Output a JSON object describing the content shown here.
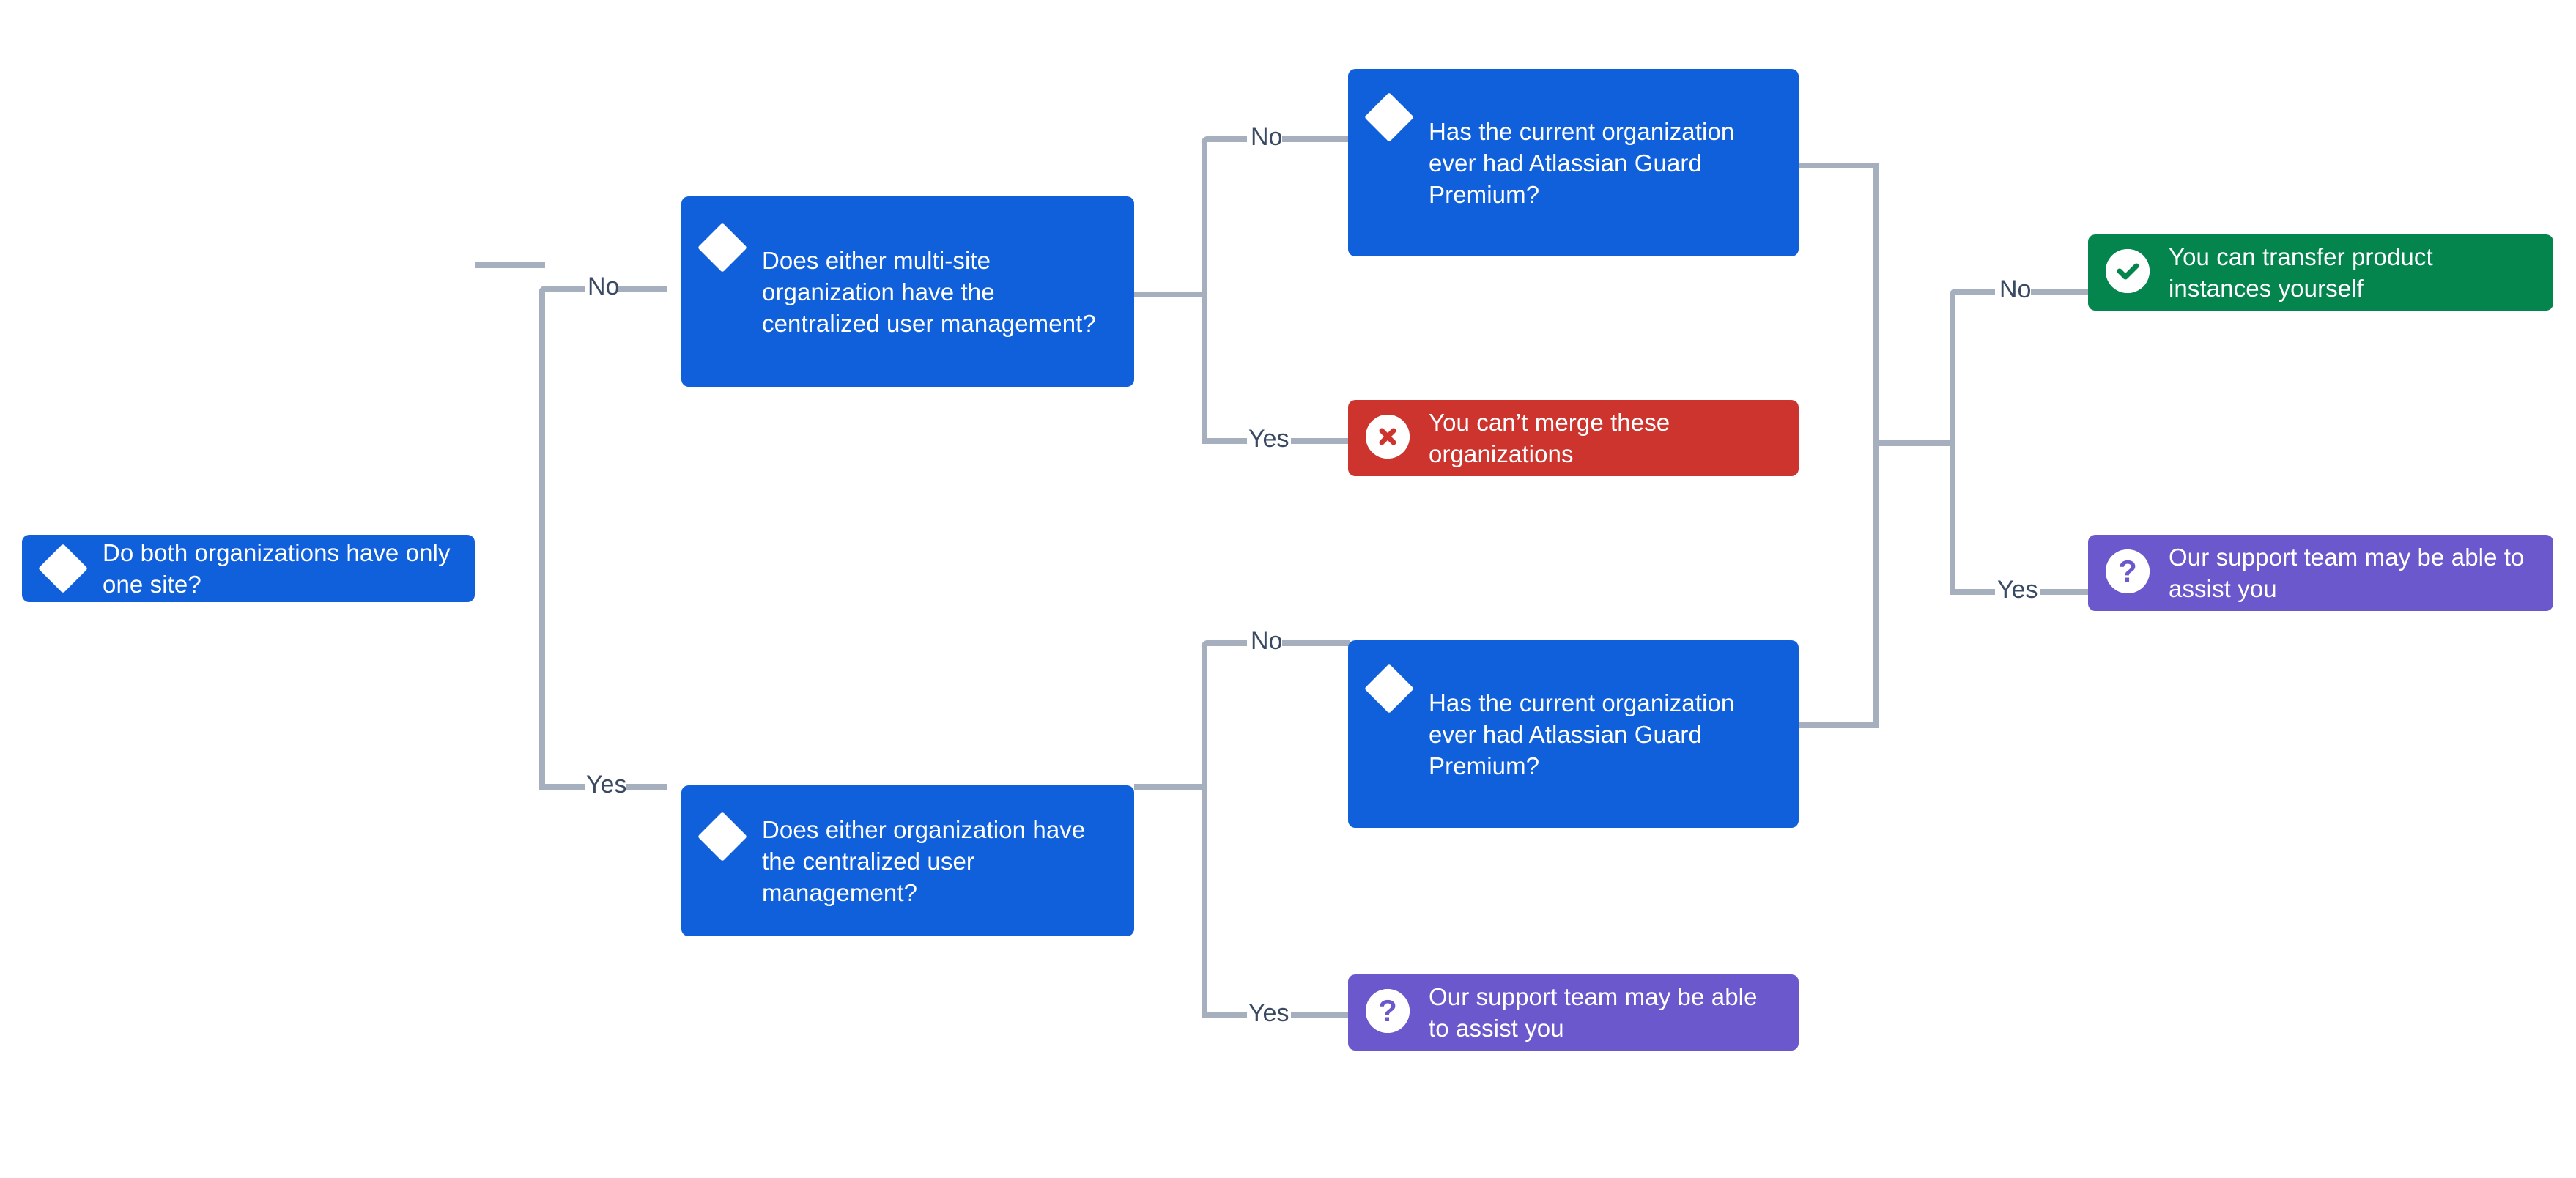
{
  "diagram": {
    "type": "decision-tree",
    "title": "Organization merge decision tree",
    "colors": {
      "decision": "#1060DC",
      "error": "#CC342D",
      "success": "#04854E",
      "info": "#6A58CC",
      "connector": "#A5AFBE",
      "edge_label": "#3B4A63",
      "background": "#FFFFFF"
    },
    "nodes": [
      {
        "id": "root",
        "kind": "decision",
        "icon": "diamond-icon",
        "text": "Do both organizations have only one site?"
      },
      {
        "id": "multisite-cum",
        "kind": "decision",
        "icon": "diamond-icon",
        "text": "Does either multi-site organization have the centralized user management?"
      },
      {
        "id": "guard-top",
        "kind": "decision",
        "icon": "diamond-icon",
        "text": "Has the current organization ever had Atlassian Guard Premium?"
      },
      {
        "id": "cannot-merge",
        "kind": "error",
        "icon": "error-cross-icon",
        "text": "You can’t merge these organizations"
      },
      {
        "id": "single-cum",
        "kind": "decision",
        "icon": "diamond-icon",
        "text": "Does either organization have the centralized user management?"
      },
      {
        "id": "guard-bottom",
        "kind": "decision",
        "icon": "diamond-icon",
        "text": "Has the current organization ever had Atlassian Guard Premium?"
      },
      {
        "id": "support-bottom",
        "kind": "info",
        "icon": "question-mark-icon",
        "text": "Our support team may be able to assist you"
      },
      {
        "id": "transfer-yourself",
        "kind": "success",
        "icon": "check-circle-icon",
        "text": "You can transfer product instances yourself"
      },
      {
        "id": "support-right",
        "kind": "info",
        "icon": "question-mark-icon",
        "text": "Our support team may be able to assist you"
      }
    ],
    "edge_labels": {
      "root_no": "No",
      "root_yes": "Yes",
      "multisite_no": "No",
      "multisite_yes": "Yes",
      "single_no": "No",
      "single_yes": "Yes",
      "guard_no": "No",
      "guard_yes": "Yes"
    },
    "edges": [
      {
        "from": "root",
        "to": "multisite-cum",
        "label": "No"
      },
      {
        "from": "root",
        "to": "single-cum",
        "label": "Yes"
      },
      {
        "from": "multisite-cum",
        "to": "guard-top",
        "label": "No"
      },
      {
        "from": "multisite-cum",
        "to": "cannot-merge",
        "label": "Yes"
      },
      {
        "from": "single-cum",
        "to": "guard-bottom",
        "label": "No"
      },
      {
        "from": "single-cum",
        "to": "support-bottom",
        "label": "Yes"
      },
      {
        "from": "guard-top",
        "to": "transfer-yourself",
        "label": "No"
      },
      {
        "from": "guard-top",
        "to": "support-right",
        "label": "Yes"
      },
      {
        "from": "guard-bottom",
        "to": "transfer-yourself",
        "label": "No"
      },
      {
        "from": "guard-bottom",
        "to": "support-right",
        "label": "Yes"
      }
    ]
  }
}
